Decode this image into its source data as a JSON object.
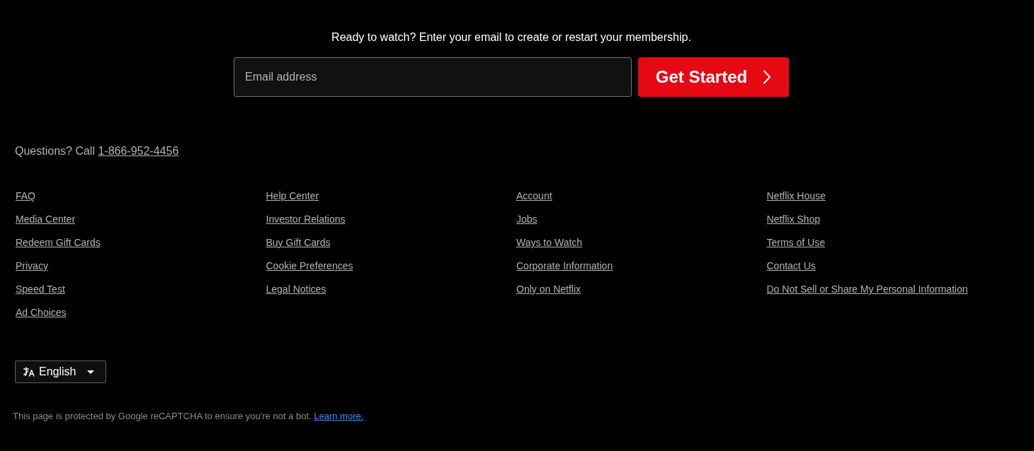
{
  "cta": {
    "prompt": "Ready to watch? Enter your email to create or restart your membership.",
    "email_field": {
      "placeholder": "Email address"
    },
    "button": "Get Started"
  },
  "contact": {
    "text": "Questions? Call",
    "phone": "1-866-952-4456"
  },
  "footer_columns": [
    [
      "FAQ",
      "Media Center",
      "Redeem Gift Cards",
      "Privacy",
      "Speed Test",
      "Ad Choices"
    ],
    [
      "Help Center",
      "Investor Relations",
      "Buy Gift Cards",
      "Cookie Preferences",
      "Legal Notices"
    ],
    [
      "Account",
      "Jobs",
      "Ways to Watch",
      "Corporate Information",
      "Only on Netflix"
    ],
    [
      "Netflix House",
      "Netflix Shop",
      "Terms of Use",
      "Contact Us",
      "Do Not Sell or Share My Personal Information"
    ]
  ],
  "language_select": {
    "value": "English"
  },
  "recaptcha": {
    "text": "This page is protected by Google reCAPTCHA to ensure you're not a bot.",
    "link": "Learn more."
  }
}
